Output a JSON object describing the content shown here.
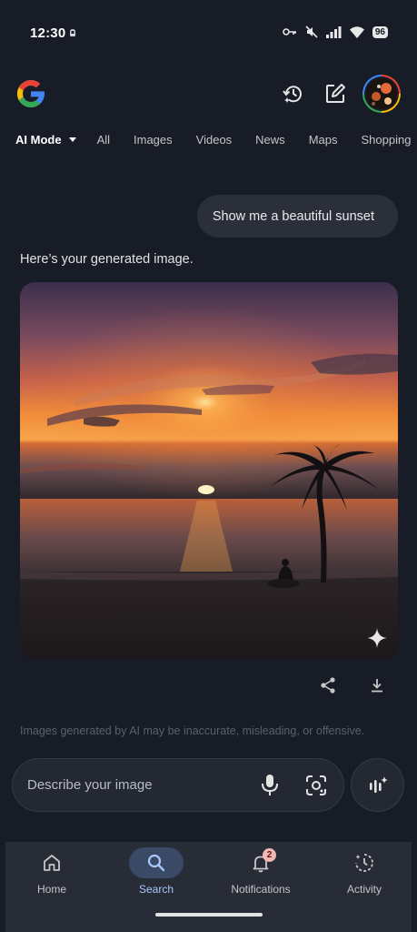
{
  "status": {
    "time": "12:30",
    "battery": "96"
  },
  "header": {
    "logo_icon": "google-g-logo",
    "history_icon": "history-icon",
    "new_chat_icon": "edit-icon",
    "avatar_icon": "profile-avatar"
  },
  "tabs": [
    {
      "label": "AI Mode",
      "active": true
    },
    {
      "label": "All"
    },
    {
      "label": "Images"
    },
    {
      "label": "Videos"
    },
    {
      "label": "News"
    },
    {
      "label": "Maps"
    },
    {
      "label": "Shopping"
    }
  ],
  "chat": {
    "user_message": "Show me a beautiful sunset",
    "response_text": "Here’s your generated image.",
    "image_icon": "sparkle-icon",
    "share_icon": "share-icon",
    "download_icon": "download-icon",
    "disclaimer": "Images generated by AI may be inaccurate, misleading, or offensive."
  },
  "input": {
    "placeholder": "Describe your image",
    "mic_icon": "mic-icon",
    "lens_icon": "lens-icon",
    "voice_icon": "voice-mode-icon"
  },
  "nav": {
    "items": [
      {
        "label": "Home",
        "icon": "home-icon"
      },
      {
        "label": "Search",
        "icon": "search-icon",
        "active": true
      },
      {
        "label": "Notifications",
        "icon": "bell-icon",
        "badge": "2"
      },
      {
        "label": "Activity",
        "icon": "activity-icon"
      }
    ]
  },
  "colors": {
    "background": "#171c26",
    "active_nav": "#a8c7fa",
    "bubble": "#2a2f3a"
  }
}
